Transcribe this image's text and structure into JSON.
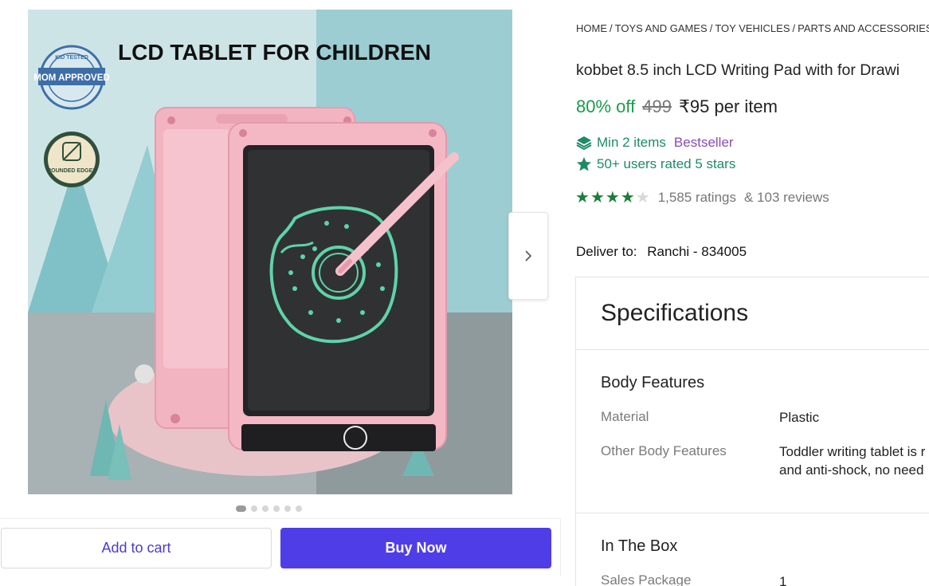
{
  "image": {
    "headline": "LCD TABLET FOR CHILDREN",
    "seal_text": "MOM APPROVED",
    "seal_ring_text": "KID TESTED",
    "badge_text": "ROUNDED EDGES"
  },
  "carousel": {
    "dot_count": 6,
    "active_index": 0
  },
  "actions": {
    "add_to_cart": "Add to cart",
    "buy_now": "Buy Now"
  },
  "breadcrumb": [
    "HOME",
    "TOYS AND GAMES",
    "TOY VEHICLES",
    "PARTS AND ACCESSORIES"
  ],
  "product": {
    "title": "kobbet 8.5 inch LCD Writing Pad with for Drawi",
    "discount": "80% off",
    "mrp": "499",
    "price": "₹95 per item",
    "min_items": "Min 2 items",
    "bestseller": "Bestseller",
    "rated": "50+ users rated 5 stars",
    "rating_value": 4,
    "rating_max": 5,
    "ratings": "1,585 ratings",
    "reviews": "& 103 reviews"
  },
  "delivery": {
    "label": "Deliver to:",
    "location": "Ranchi - 834005"
  },
  "specs": {
    "title": "Specifications",
    "body_features": {
      "heading": "Body Features",
      "material_key": "Material",
      "material_val": "Plastic",
      "other_key": "Other Body Features",
      "other_val_line1": "Toddler writing tablet is r",
      "other_val_line2": "and anti-shock, no need"
    },
    "in_the_box": {
      "heading": "In The Box",
      "sales_package_key": "Sales Package",
      "sales_package_val": "1"
    }
  },
  "colors": {
    "accent": "#4f3ee8",
    "discount_green": "#1a9b4b",
    "star_green": "#1a7d3b",
    "bestseller_purple": "#8a4ab9",
    "tablet_pink": "#f3b3c0",
    "drawing_mint": "#5fd3a8"
  },
  "icons": {
    "next": "chevron-right-icon",
    "layers": "layers-icon",
    "star_badge": "star-badge-icon",
    "trash": "trash-icon"
  }
}
